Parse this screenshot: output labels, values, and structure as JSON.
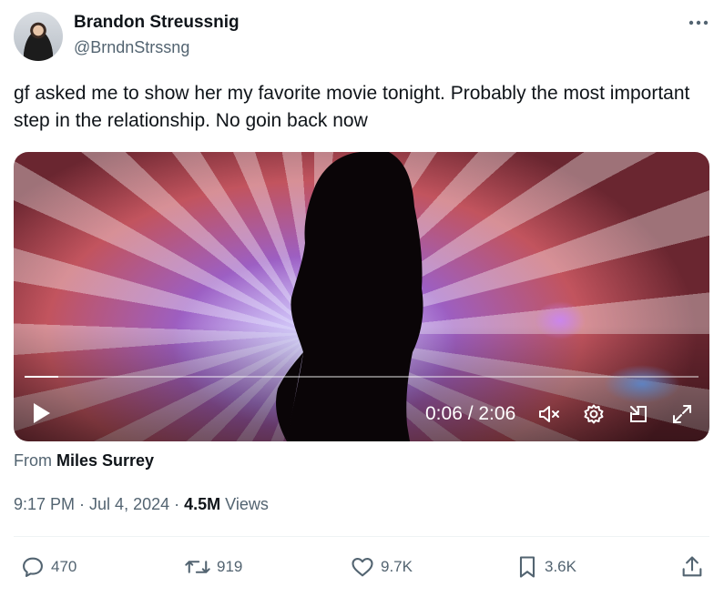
{
  "author": {
    "display_name": "Brandon Streussnig",
    "handle": "@BrndnStrssng"
  },
  "tweet": {
    "text": "gf asked me to show her my favorite movie tonight. Probably the most important step in the relationship. No goin back now"
  },
  "video": {
    "time_display": "0:06 / 2:06",
    "progress_fraction": 0.05
  },
  "attribution": {
    "prefix": "From",
    "source": "Miles Surrey"
  },
  "meta": {
    "time": "9:17 PM",
    "separator1": " · ",
    "date": "Jul 4, 2024",
    "separator2": " · ",
    "views_count": "4.5M",
    "views_label": " Views"
  },
  "actions": {
    "replies": "470",
    "reposts": "919",
    "likes": "9.7K",
    "bookmarks": "3.6K"
  },
  "icons": {
    "more": "more-icon",
    "play": "play-icon",
    "mute": "mute-icon",
    "settings": "gear-icon",
    "minimize": "minimize-icon",
    "fullscreen": "fullscreen-icon",
    "reply": "reply-icon",
    "repost": "repost-icon",
    "like": "heart-icon",
    "bookmark": "bookmark-icon",
    "share": "share-icon"
  },
  "colors": {
    "text_primary": "#0f1419",
    "text_secondary": "#536471"
  }
}
